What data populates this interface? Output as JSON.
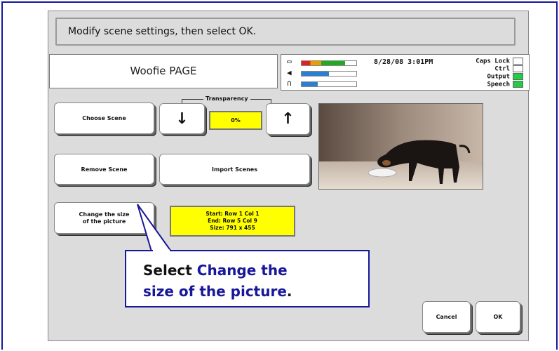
{
  "prompt": "Modify scene settings, then select OK.",
  "page_title": "Woofie PAGE",
  "status": {
    "datetime": "8/28/08 3:01PM",
    "indicators": [
      {
        "label": "Caps Lock",
        "color": "#ffffff"
      },
      {
        "label": "Ctrl",
        "color": "#ffffff"
      },
      {
        "label": "Output",
        "color": "#22cc44"
      },
      {
        "label": "Speech",
        "color": "#22cc44"
      }
    ],
    "meters": [
      {
        "icon": "battery-icon",
        "level": 0.8
      },
      {
        "icon": "speaker-icon",
        "level": 0.5
      },
      {
        "icon": "headphones-icon",
        "level": 0.3
      }
    ]
  },
  "buttons": {
    "choose_scene": "Choose Scene",
    "remove_scene": "Remove Scene",
    "import_scenes": "Import Scenes",
    "change_size_line1": "Change the size",
    "change_size_line2": "of the picture",
    "cancel": "Cancel",
    "ok": "OK",
    "decrease": "↓",
    "increase": "↑"
  },
  "transparency": {
    "label": "Transparency",
    "value": "0%"
  },
  "info": {
    "line1": "Start: Row 1 Col 1",
    "line2": "End: Row 5 Col 9",
    "line3": "Size: 791 x 455"
  },
  "callout": {
    "prefix": "Select ",
    "highlight_line1": "Change the",
    "highlight_line2": "size of the picture",
    "suffix": "."
  }
}
